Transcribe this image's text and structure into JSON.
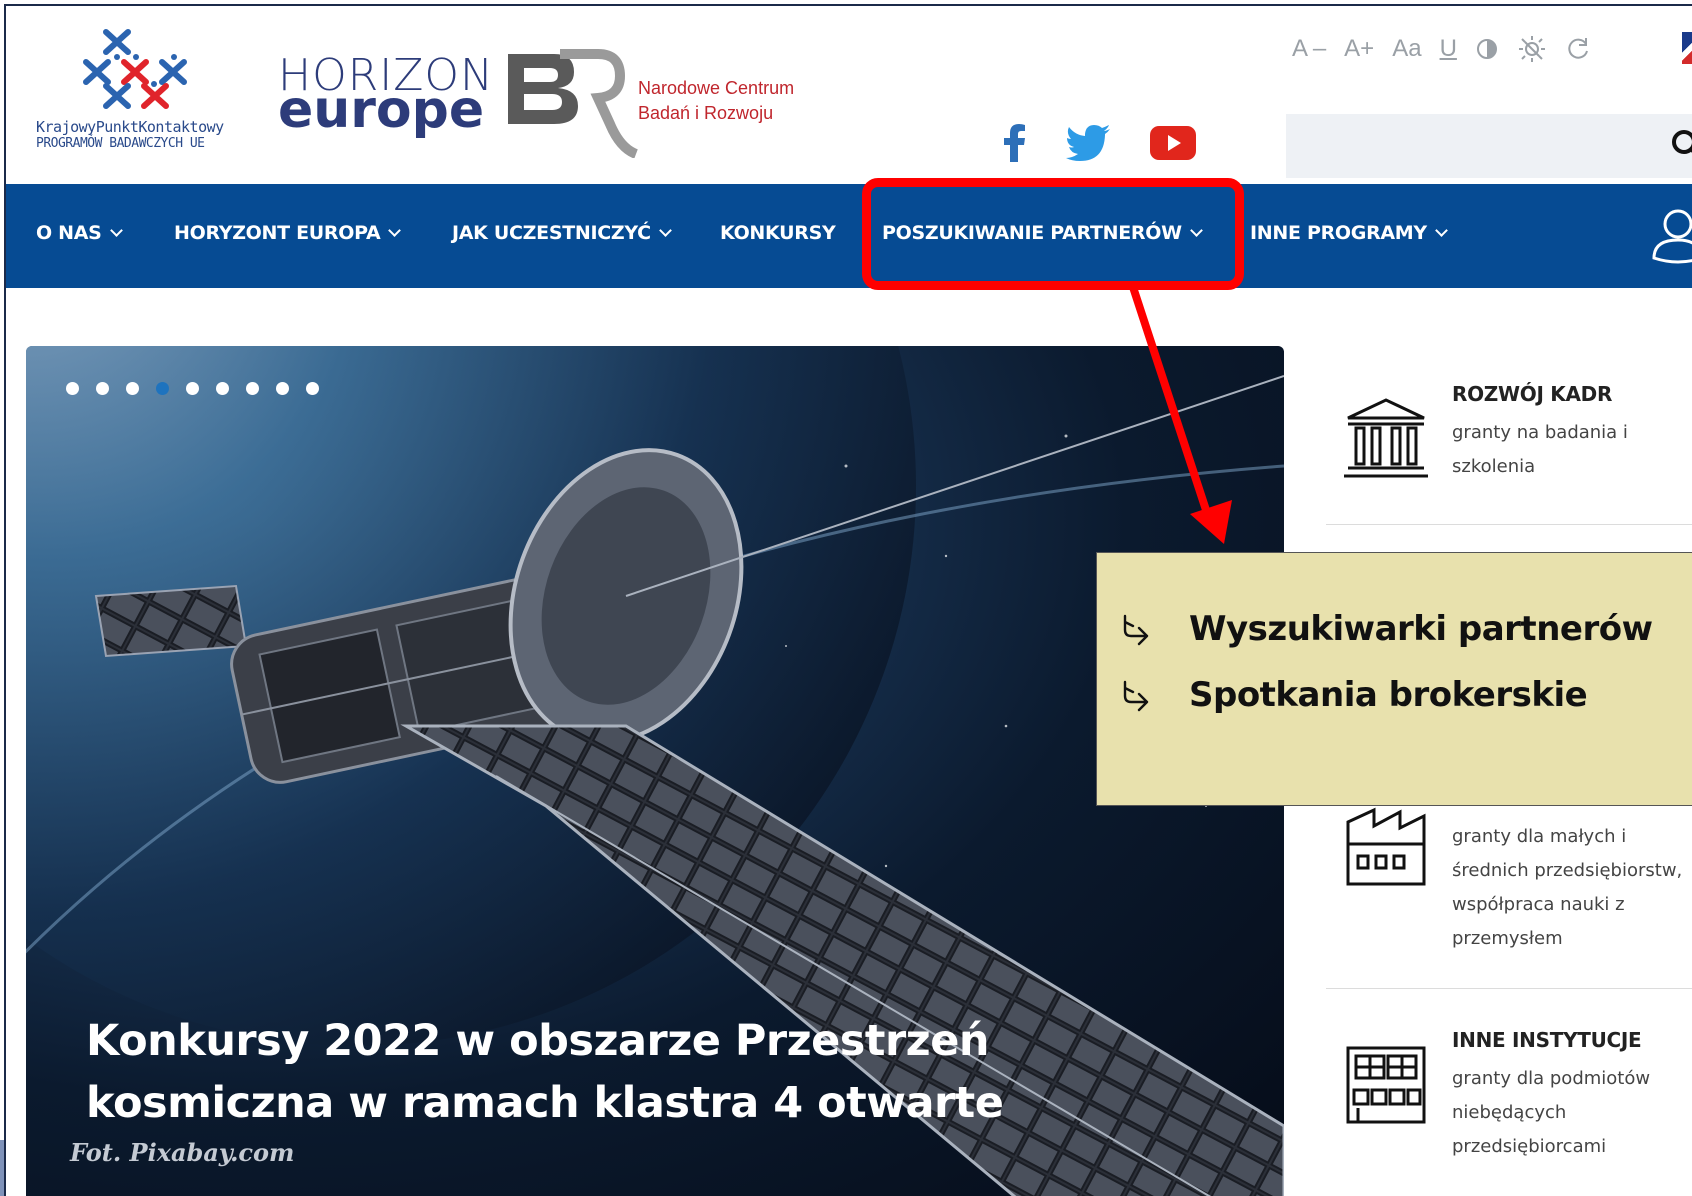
{
  "header": {
    "kpk_logo": {
      "line1": "KrajowyPunktKontaktowy",
      "line2": "PROGRAMÓW BADAWCZYCH UE"
    },
    "horizon_logo": {
      "line1": "HORIZON",
      "line2": "europe"
    },
    "ncbr_logo": {
      "line1": "Narodowe Centrum",
      "line2": "Badań i Rozwoju"
    },
    "accessibility": {
      "font_decrease": "A –",
      "font_increase": "A+",
      "font_toggle": "Aa",
      "underline": "U"
    },
    "social": [
      "facebook-icon",
      "twitter-icon",
      "youtube-icon"
    ],
    "search": {
      "placeholder": ""
    }
  },
  "nav": {
    "items": [
      {
        "label": "O NAS",
        "has_dropdown": true
      },
      {
        "label": "HORYZONT EUROPA",
        "has_dropdown": true
      },
      {
        "label": "JAK UCZESTNICZYĆ",
        "has_dropdown": true
      },
      {
        "label": "KONKURSY",
        "has_dropdown": false
      },
      {
        "label": "POSZUKIWANIE PARTNERÓW",
        "has_dropdown": true
      },
      {
        "label": "INNE PROGRAMY",
        "has_dropdown": true
      }
    ],
    "highlighted": "POSZUKIWANIE PARTNERÓW"
  },
  "hero": {
    "slides_count": 9,
    "active_slide": 4,
    "title": "Konkursy 2022 w obszarze Przestrzeń kosmiczna w ramach klastra 4 otwarte",
    "credit": "Fot. Pixabay.com"
  },
  "side_list": [
    {
      "icon": "institution-icon",
      "title": "ROZWÓJ KADR",
      "desc": "granty na badania i szkolenia"
    },
    {
      "icon": "factory-icon",
      "title": "",
      "desc": "granty dla małych i średnich przedsiębiorstw, współpraca nauki z przemysłem"
    },
    {
      "icon": "office-building-icon",
      "title": "INNE INSTYTUCJE",
      "desc": "granty dla podmiotów niebędących przedsiębiorcami"
    }
  ],
  "callout": {
    "items": [
      "Wyszukiwarki partnerów",
      "Spotkania brokerskie"
    ],
    "bullet_icon": "hand-pointer-icon",
    "background": "#e8e1ad"
  },
  "colors": {
    "nav_bg": "#064b93",
    "highlight": "#ff0000",
    "active_dot": "#1e73be"
  }
}
